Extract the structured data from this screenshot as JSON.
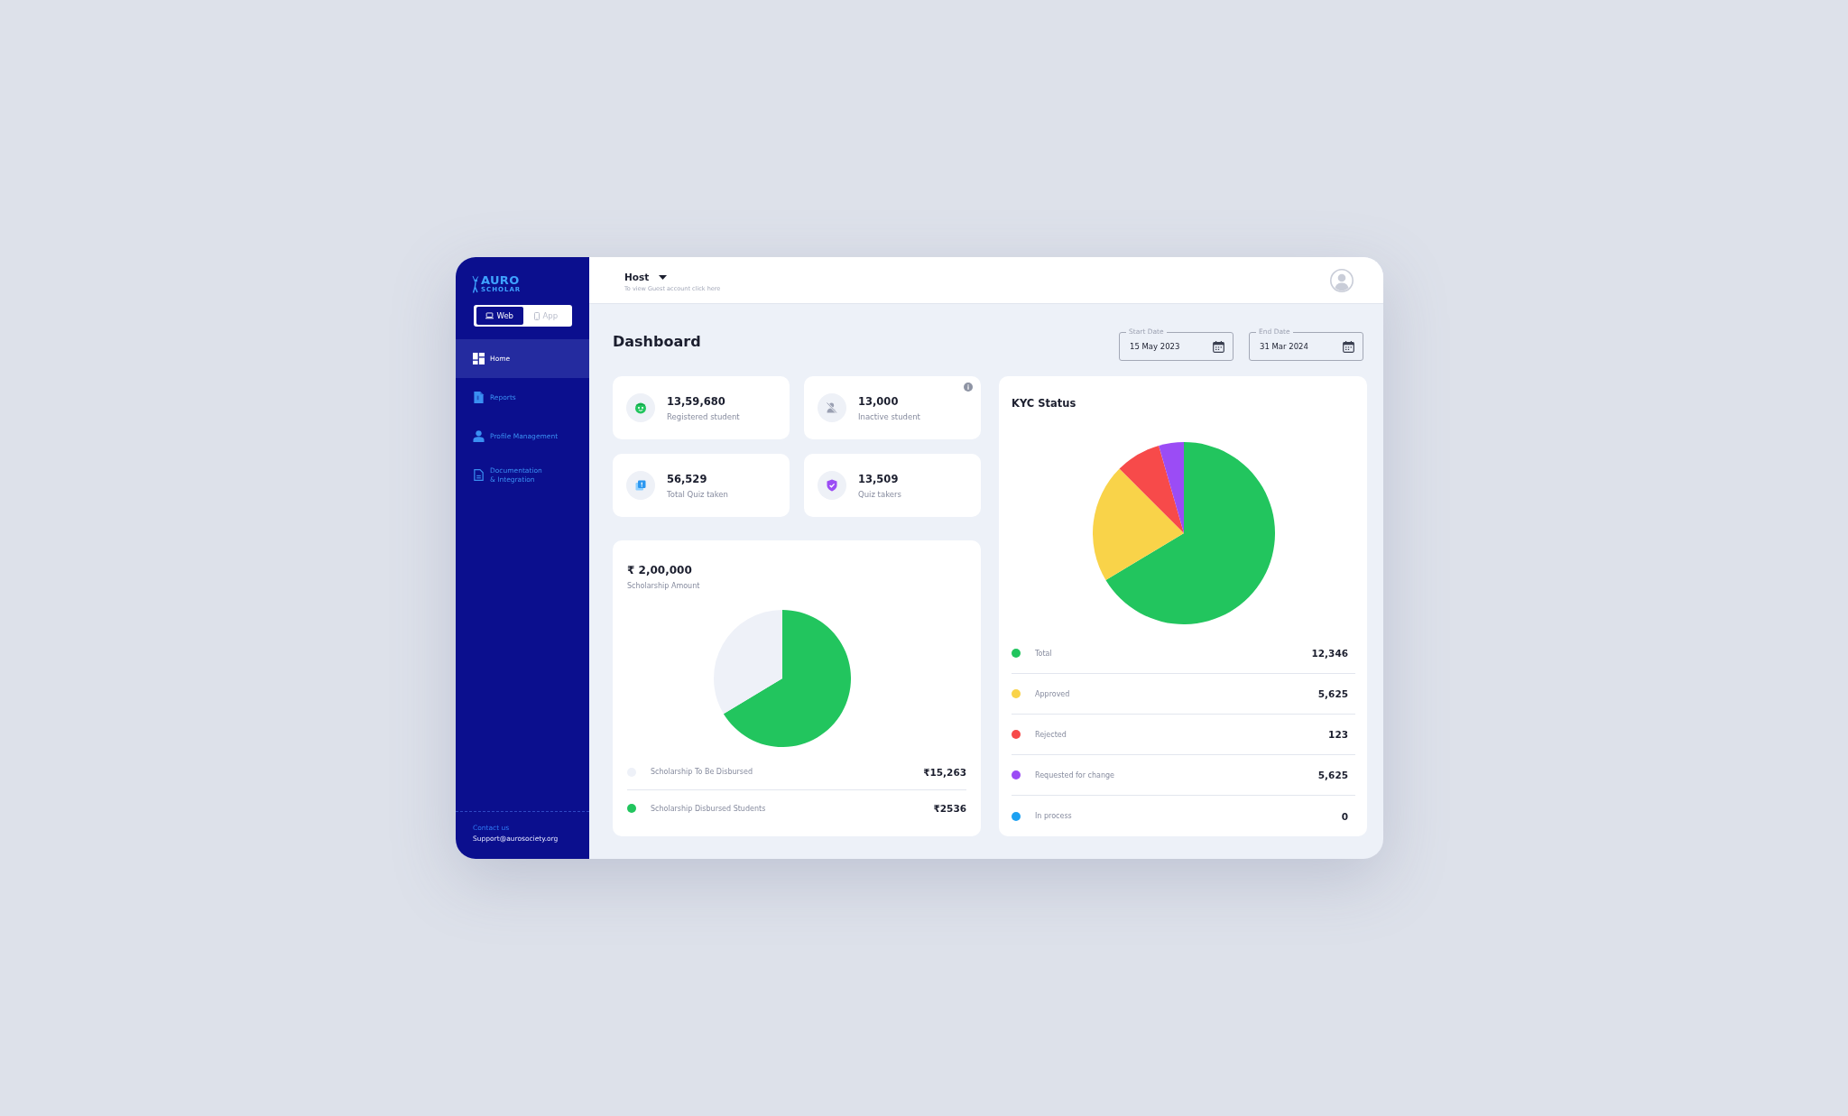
{
  "sidebar": {
    "logo": {
      "wordmark": "AURO",
      "tagline": "SCHOLAR"
    },
    "platform_tabs": [
      {
        "label": "Web",
        "selected": true
      },
      {
        "label": "App",
        "selected": false
      }
    ],
    "nav": [
      {
        "label": "Home",
        "selected": true
      },
      {
        "label": "Reports",
        "selected": false
      },
      {
        "label": "Profile Management",
        "selected": false
      },
      {
        "label": "Documentation & Integration",
        "selected": false
      }
    ],
    "footer": {
      "contact_label": "Contact us",
      "email": "Support@aurosociety.org"
    }
  },
  "header": {
    "account": "Host",
    "hint": "To view Guest account click here"
  },
  "page": {
    "title": "Dashboard",
    "date_fields": [
      {
        "label": "Start Date",
        "value": "15 May 2023"
      },
      {
        "label": "End Date",
        "value": "31 Mar 2024"
      }
    ]
  },
  "stats": [
    {
      "value": "13,59,680",
      "label": "Registered student",
      "info": false
    },
    {
      "value": "13,000",
      "label": "Inactive student",
      "info": true
    },
    {
      "value": "56,529",
      "label": "Total Quiz taken",
      "info": false
    },
    {
      "value": "13,509",
      "label": "Quiz takers",
      "info": false
    }
  ],
  "scholarship": {
    "amount": "₹ 2,00,000",
    "label": "Scholarship Amount",
    "legend": [
      {
        "label": "Scholarship To Be Disbursed",
        "value": "₹15,263",
        "color": "#eef1f8"
      },
      {
        "label": "Scholarship Disbursed Students",
        "value": "₹2536",
        "color": "#22c55e"
      }
    ]
  },
  "kyc": {
    "title": "KYC Status",
    "legend": [
      {
        "label": "Total",
        "value": "12,346",
        "color": "#22c55e"
      },
      {
        "label": "Approved",
        "value": "5,625",
        "color": "#f9d349"
      },
      {
        "label": "Rejected",
        "value": "123",
        "color": "#f74a4a"
      },
      {
        "label": "Requested for change",
        "value": "5,625",
        "color": "#9b4cf5"
      },
      {
        "label": "In process",
        "value": "0",
        "color": "#1da1f2"
      }
    ]
  }
}
